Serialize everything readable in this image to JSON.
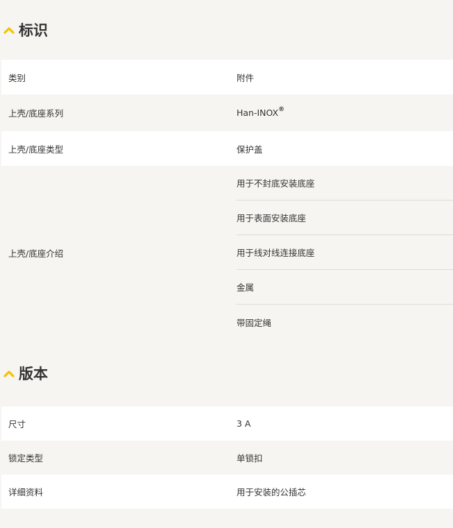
{
  "accent_color": "#f5c200",
  "sections": [
    {
      "title": "标识",
      "icon": "chevron-up-icon",
      "rows": [
        {
          "label": "类别",
          "value": "附件"
        },
        {
          "label": "上壳/底座系列",
          "value": "Han-INOX",
          "value_suffix": "®"
        },
        {
          "label": "上壳/底座类型",
          "value": "保护盖"
        },
        {
          "label": "上壳/底座介绍",
          "values": [
            "用于不封底安装底座",
            "用于表面安装底座",
            "用于线对线连接底座",
            "金属",
            "带固定绳"
          ]
        }
      ]
    },
    {
      "title": "版本",
      "icon": "chevron-up-icon",
      "rows": [
        {
          "label": "尺寸",
          "value": "3 A"
        },
        {
          "label": "锁定类型",
          "value": "单锁扣"
        },
        {
          "label": "详细资料",
          "value": "用于安装的公插芯"
        }
      ]
    }
  ]
}
